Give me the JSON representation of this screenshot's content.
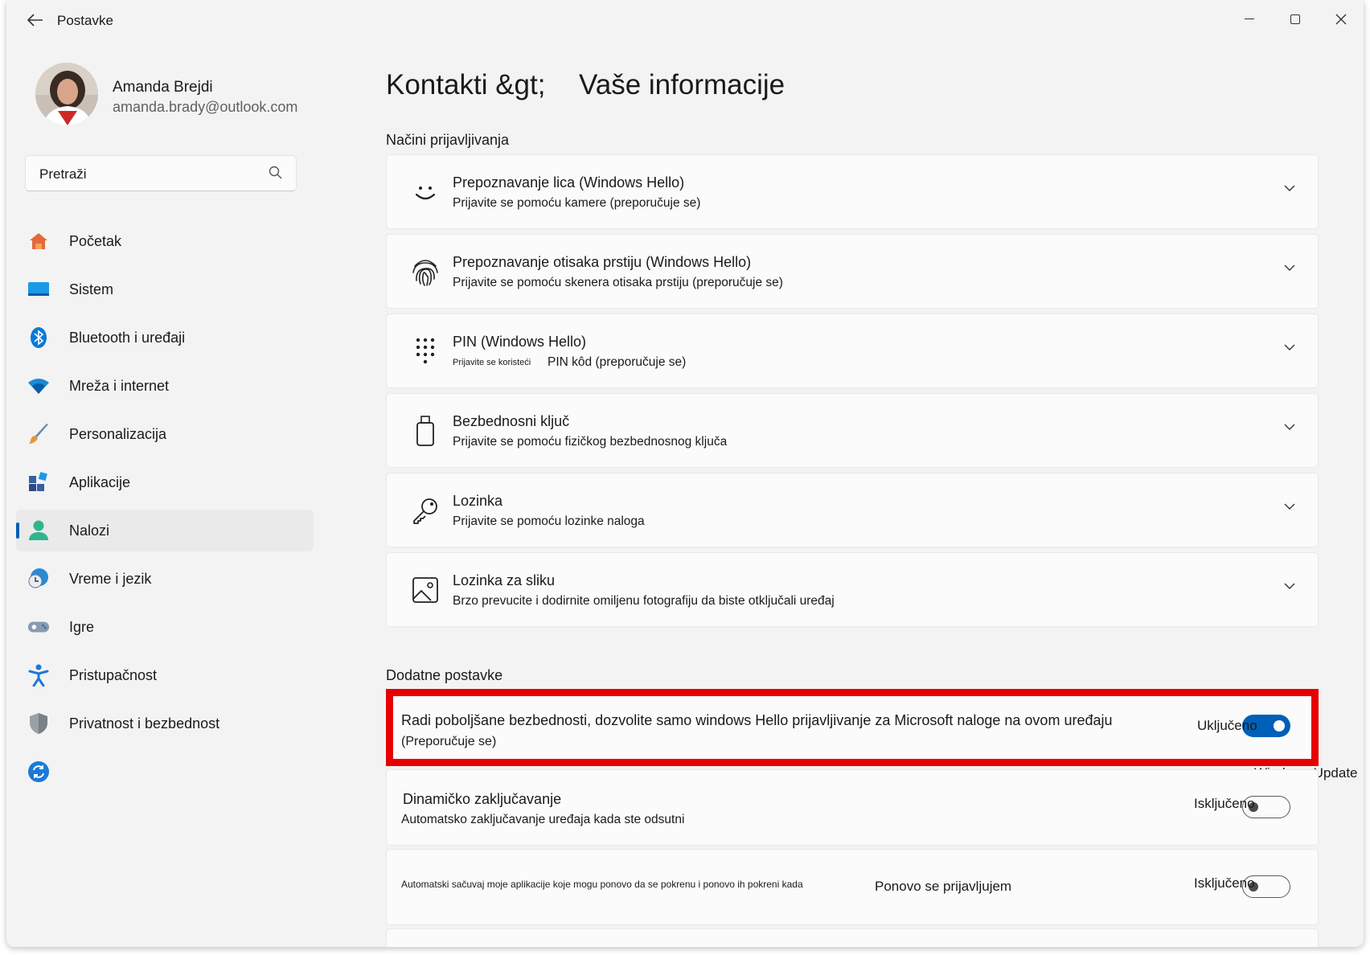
{
  "window": {
    "title": "Postavke"
  },
  "profile": {
    "name": "Amanda Brejdi",
    "email": "amanda.brady@outlook.com"
  },
  "search": {
    "placeholder": "Pretraži"
  },
  "sidebar": {
    "items": [
      {
        "label": "Početak",
        "icon": "home-icon",
        "color": "#e3693a"
      },
      {
        "label": "Sistem",
        "icon": "system-icon",
        "color": "#0a84d6"
      },
      {
        "label": "Bluetooth i uređaji",
        "icon": "bluetooth-icon",
        "color": "#0a7ad6"
      },
      {
        "label": "Mreža i internet",
        "icon": "wifi-icon",
        "color": "#1a8ad6"
      },
      {
        "label": "Personalizacija",
        "icon": "brush-icon",
        "color": "#e09a3a"
      },
      {
        "label": "Aplikacije",
        "icon": "apps-icon",
        "color": "#3a5ea0"
      },
      {
        "label": "Nalozi",
        "icon": "accounts-icon",
        "color": "#2fb58c",
        "active": true
      },
      {
        "label": "Vreme i jezik",
        "icon": "clock-globe-icon",
        "color": "#2a8ad6"
      },
      {
        "label": "Igre",
        "icon": "gamepad-icon",
        "color": "#7a8aa0"
      },
      {
        "label": "Pristupačnost",
        "icon": "accessibility-icon",
        "color": "#1a7ad6"
      },
      {
        "label": "Privatnost i bezbednost",
        "icon": "shield-icon",
        "color": "#8a8f96"
      },
      {
        "label": "",
        "icon": "windows-update-icon",
        "color": "#1a7ad6"
      }
    ]
  },
  "page": {
    "breadcrumb_parent": "Kontakti &gt;",
    "breadcrumb_current": "Vaše informacije",
    "signin_section": "Načini prijavljivanja",
    "signin_options": [
      {
        "title": "Prepoznavanje lica (Windows Hello)",
        "subtitle": "Prijavite se pomoću kamere (preporučuje se)",
        "icon": "face-icon"
      },
      {
        "title": "Prepoznavanje otisaka prstiju (Windows Hello)",
        "subtitle": "Prijavite se pomoću skenera otisaka prstiju (preporučuje se)",
        "icon": "fingerprint-icon"
      },
      {
        "title": "PIN (Windows Hello)",
        "subtitle_small": "Prijavite se koristeći",
        "subtitle": "PIN kôd (preporučuje se)",
        "icon": "keypad-icon"
      },
      {
        "title": "Bezbednosni ključ",
        "subtitle": "Prijavite se pomoću fizičkog bezbednosnog ključa",
        "icon": "usb-key-icon"
      },
      {
        "title": "Lozinka",
        "subtitle": "Prijavite se pomoću lozinke naloga",
        "icon": "key-icon"
      },
      {
        "title": "Lozinka za sliku",
        "subtitle": "Brzo prevucite i dodirnite omiljenu fotografiju da biste otključali uređaj",
        "icon": "picture-icon"
      }
    ],
    "additional_section": "Dodatne postavke",
    "settings": [
      {
        "title": "Radi poboljšane bezbednosti, dozvolite samo windows Hello prijavljivanje za Microsoft naloge na ovom uređaju",
        "subtitle": "(Preporučuje se)",
        "state": "Uključeno",
        "on": true
      },
      {
        "title": "Dinamičko zaključavanje",
        "subtitle": "Automatsko zaključavanje uređaja kada ste odsutni",
        "state": "Isključeno",
        "on": false
      },
      {
        "title_small": "Automatski sačuvaj moje aplikacije koje mogu ponovo da se pokrenu i ponovo ih pokreni kada",
        "title": "Ponovo se prijavljujem",
        "state": "Isključeno",
        "on": false
      }
    ],
    "overlay_label": "Windows Update"
  },
  "colors": {
    "accent": "#005fb8",
    "highlight_border": "#e60000"
  }
}
